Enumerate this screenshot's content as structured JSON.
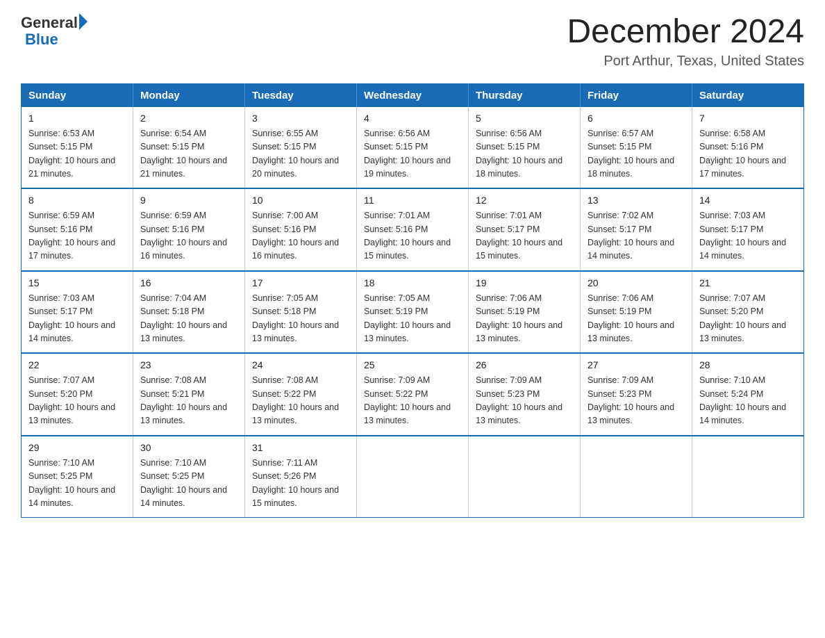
{
  "logo": {
    "text_general": "General",
    "text_blue": "Blue"
  },
  "title": "December 2024",
  "subtitle": "Port Arthur, Texas, United States",
  "days_of_week": [
    "Sunday",
    "Monday",
    "Tuesday",
    "Wednesday",
    "Thursday",
    "Friday",
    "Saturday"
  ],
  "weeks": [
    [
      {
        "day": "1",
        "sunrise": "6:53 AM",
        "sunset": "5:15 PM",
        "daylight": "10 hours and 21 minutes."
      },
      {
        "day": "2",
        "sunrise": "6:54 AM",
        "sunset": "5:15 PM",
        "daylight": "10 hours and 21 minutes."
      },
      {
        "day": "3",
        "sunrise": "6:55 AM",
        "sunset": "5:15 PM",
        "daylight": "10 hours and 20 minutes."
      },
      {
        "day": "4",
        "sunrise": "6:56 AM",
        "sunset": "5:15 PM",
        "daylight": "10 hours and 19 minutes."
      },
      {
        "day": "5",
        "sunrise": "6:56 AM",
        "sunset": "5:15 PM",
        "daylight": "10 hours and 18 minutes."
      },
      {
        "day": "6",
        "sunrise": "6:57 AM",
        "sunset": "5:15 PM",
        "daylight": "10 hours and 18 minutes."
      },
      {
        "day": "7",
        "sunrise": "6:58 AM",
        "sunset": "5:16 PM",
        "daylight": "10 hours and 17 minutes."
      }
    ],
    [
      {
        "day": "8",
        "sunrise": "6:59 AM",
        "sunset": "5:16 PM",
        "daylight": "10 hours and 17 minutes."
      },
      {
        "day": "9",
        "sunrise": "6:59 AM",
        "sunset": "5:16 PM",
        "daylight": "10 hours and 16 minutes."
      },
      {
        "day": "10",
        "sunrise": "7:00 AM",
        "sunset": "5:16 PM",
        "daylight": "10 hours and 16 minutes."
      },
      {
        "day": "11",
        "sunrise": "7:01 AM",
        "sunset": "5:16 PM",
        "daylight": "10 hours and 15 minutes."
      },
      {
        "day": "12",
        "sunrise": "7:01 AM",
        "sunset": "5:17 PM",
        "daylight": "10 hours and 15 minutes."
      },
      {
        "day": "13",
        "sunrise": "7:02 AM",
        "sunset": "5:17 PM",
        "daylight": "10 hours and 14 minutes."
      },
      {
        "day": "14",
        "sunrise": "7:03 AM",
        "sunset": "5:17 PM",
        "daylight": "10 hours and 14 minutes."
      }
    ],
    [
      {
        "day": "15",
        "sunrise": "7:03 AM",
        "sunset": "5:17 PM",
        "daylight": "10 hours and 14 minutes."
      },
      {
        "day": "16",
        "sunrise": "7:04 AM",
        "sunset": "5:18 PM",
        "daylight": "10 hours and 13 minutes."
      },
      {
        "day": "17",
        "sunrise": "7:05 AM",
        "sunset": "5:18 PM",
        "daylight": "10 hours and 13 minutes."
      },
      {
        "day": "18",
        "sunrise": "7:05 AM",
        "sunset": "5:19 PM",
        "daylight": "10 hours and 13 minutes."
      },
      {
        "day": "19",
        "sunrise": "7:06 AM",
        "sunset": "5:19 PM",
        "daylight": "10 hours and 13 minutes."
      },
      {
        "day": "20",
        "sunrise": "7:06 AM",
        "sunset": "5:19 PM",
        "daylight": "10 hours and 13 minutes."
      },
      {
        "day": "21",
        "sunrise": "7:07 AM",
        "sunset": "5:20 PM",
        "daylight": "10 hours and 13 minutes."
      }
    ],
    [
      {
        "day": "22",
        "sunrise": "7:07 AM",
        "sunset": "5:20 PM",
        "daylight": "10 hours and 13 minutes."
      },
      {
        "day": "23",
        "sunrise": "7:08 AM",
        "sunset": "5:21 PM",
        "daylight": "10 hours and 13 minutes."
      },
      {
        "day": "24",
        "sunrise": "7:08 AM",
        "sunset": "5:22 PM",
        "daylight": "10 hours and 13 minutes."
      },
      {
        "day": "25",
        "sunrise": "7:09 AM",
        "sunset": "5:22 PM",
        "daylight": "10 hours and 13 minutes."
      },
      {
        "day": "26",
        "sunrise": "7:09 AM",
        "sunset": "5:23 PM",
        "daylight": "10 hours and 13 minutes."
      },
      {
        "day": "27",
        "sunrise": "7:09 AM",
        "sunset": "5:23 PM",
        "daylight": "10 hours and 13 minutes."
      },
      {
        "day": "28",
        "sunrise": "7:10 AM",
        "sunset": "5:24 PM",
        "daylight": "10 hours and 14 minutes."
      }
    ],
    [
      {
        "day": "29",
        "sunrise": "7:10 AM",
        "sunset": "5:25 PM",
        "daylight": "10 hours and 14 minutes."
      },
      {
        "day": "30",
        "sunrise": "7:10 AM",
        "sunset": "5:25 PM",
        "daylight": "10 hours and 14 minutes."
      },
      {
        "day": "31",
        "sunrise": "7:11 AM",
        "sunset": "5:26 PM",
        "daylight": "10 hours and 15 minutes."
      },
      null,
      null,
      null,
      null
    ]
  ],
  "labels": {
    "sunrise": "Sunrise:",
    "sunset": "Sunset:",
    "daylight": "Daylight:"
  },
  "colors": {
    "header_bg": "#1a6bb5",
    "header_text": "#ffffff",
    "border": "#1a6bb5"
  }
}
